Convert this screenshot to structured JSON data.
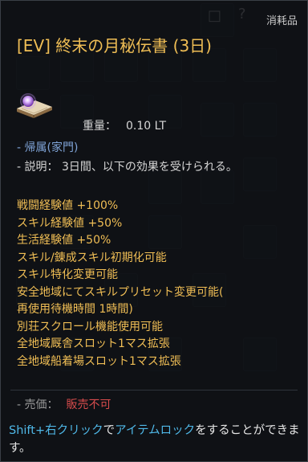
{
  "tooltip": {
    "category": "消耗品",
    "title": "[EV] 終末の月秘伝書 (3日)",
    "icon": "book-with-purple-orb-icon",
    "weight_label": "重量：",
    "weight_value": "0.10 LT",
    "binding": "- 帰属(家門)",
    "description": "- 説明： 3日間、以下の効果を受けられる。",
    "effects": [
      "戦闘経験値 +100%",
      "スキル経験値 +50%",
      "生活経験値 +50%",
      "スキル/錬成スキル初期化可能",
      "スキル特化変更可能",
      "安全地域にてスキルプリセット変更可能(",
      "再使用待機時間 1時間)",
      "別荘スクロール機能使用可能",
      "全地域厩舎スロット1マス拡張",
      "全地域船着場スロット1マス拡張"
    ],
    "price_label": "- 売価：",
    "price_value": "販売不可",
    "hint": {
      "part1": "Shift+右クリック",
      "part2": "で",
      "part3": "アイテムロック",
      "part4": "をすることができます。"
    },
    "colors": {
      "title": "#f0be55",
      "binding": "#7fa3d6",
      "price": "#d84c4c",
      "hint_highlight": "#4fb8e8"
    }
  }
}
